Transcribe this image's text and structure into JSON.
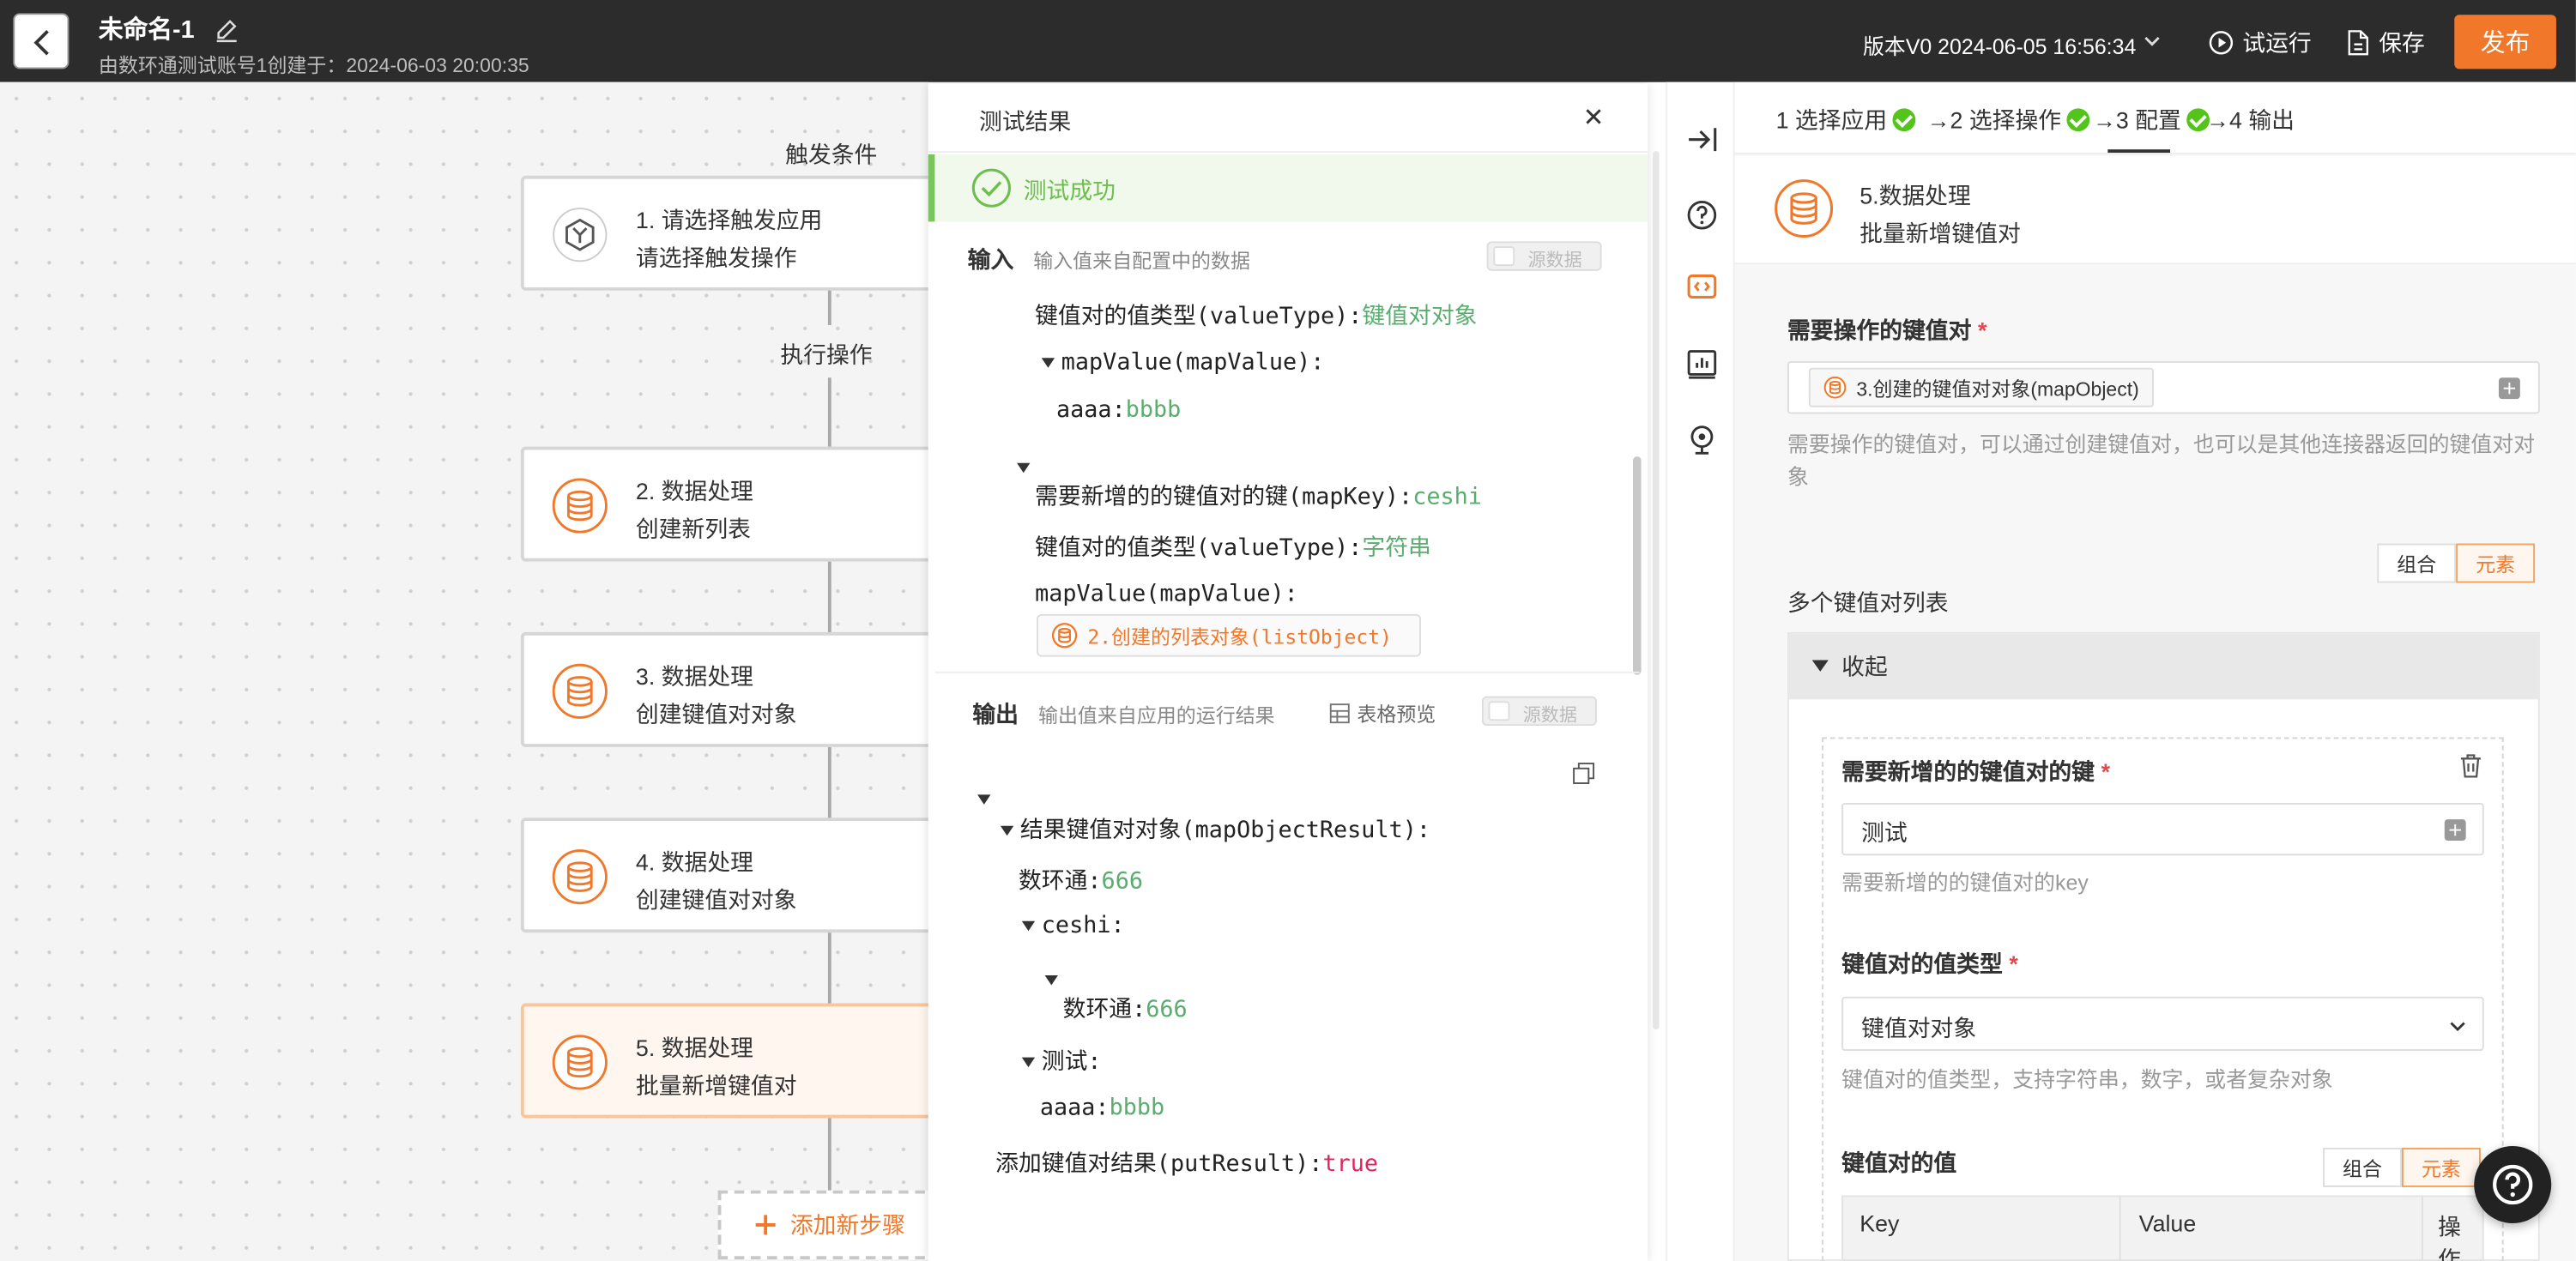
{
  "header": {
    "title": "未命名-1",
    "subtitle": "由数环通测试账号1创建于：2024-06-03 20:00:35",
    "version": "版本V0 2024-06-05 16:56:34",
    "run_label": "试运行",
    "save_label": "保存",
    "publish_label": "发布"
  },
  "flow": {
    "trigger_label": "触发条件",
    "action_label": "执行操作",
    "add_step_label": "添加新步骤",
    "nodes": [
      {
        "title": "1. 请选择触发应用",
        "subtitle": "请选择触发操作"
      },
      {
        "title": "2. 数据处理",
        "subtitle": "创建新列表"
      },
      {
        "title": "3. 数据处理",
        "subtitle": "创建键值对对象"
      },
      {
        "title": "4. 数据处理",
        "subtitle": "创建键值对对象"
      },
      {
        "title": "5. 数据处理",
        "subtitle": "批量新增键值对"
      }
    ]
  },
  "test": {
    "title": "测试结果",
    "status": "测试成功",
    "input_title": "输入",
    "input_hint": "输入值来自配置中的数据",
    "output_title": "输出",
    "output_hint": "输出值来自应用的运行结果",
    "table_preview": "表格预览",
    "raw_toggle": "源数据",
    "input_lines": {
      "vt1_key": "键值对的值类型(valueType):",
      "vt1_val": "键值对对象",
      "mv1_key": "mapValue(mapValue):",
      "aaaa_key": "aaaa:",
      "aaaa_val": "bbbb",
      "mk_key": "需要新增的的键值对的键(mapKey):",
      "mk_val": "ceshi",
      "vt2_key": "键值对的值类型(valueType):",
      "vt2_val": "字符串",
      "mv2_key": "mapValue(mapValue):",
      "ref": "2.创建的列表对象(listObject)"
    },
    "output_lines": {
      "result_key": "结果键值对对象(mapObjectResult):",
      "shuhuan_key": "数环通:",
      "shuhuan_val": "666",
      "ceshi_key": "ceshi:",
      "shuhuan2_key": "数环通:",
      "shuhuan2_val": "666",
      "ceshi_cn_key": "测试:",
      "aaaa2_key": "aaaa:",
      "aaaa2_val": "bbbb",
      "put_key": "添加键值对结果(putResult):",
      "put_val": "true"
    }
  },
  "config": {
    "steps": [
      {
        "label": "1 选择应用"
      },
      {
        "label": "→2 选择操作"
      },
      {
        "label": "→3 配置"
      },
      {
        "label": "→4 输出"
      }
    ],
    "node_title": "5.数据处理",
    "node_subtitle": "批量新增键值对",
    "map_field_label": "需要操作的键值对",
    "map_field_chip": "3.创建的键值对对象(mapObject)",
    "map_field_help": "需要操作的键值对，可以通过创建键值对，也可以是其他连接器返回的键值对对象",
    "seg_combo": "组合",
    "seg_element": "元素",
    "list_label": "多个键值对列表",
    "collapse_label": "收起",
    "key_label": "需要新增的的键值对的键",
    "key_value": "测试",
    "key_help": "需要新增的的键值对的key",
    "type_label": "键值对的值类型",
    "type_value": "键值对对象",
    "type_help": "键值对的值类型，支持字符串，数字，或者复杂对象",
    "value_label": "键值对的值",
    "table_headers": [
      "Key",
      "Value",
      "操作"
    ]
  },
  "colors": {
    "accent": "#f1782a",
    "success": "#52c41a",
    "value_green": "#5aad6e",
    "bool_red": "#e0245e"
  }
}
